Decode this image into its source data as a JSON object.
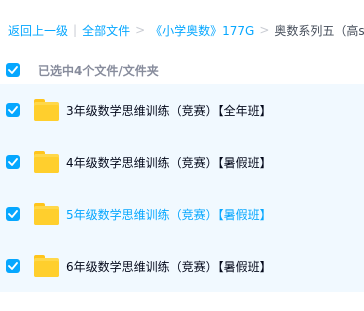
{
  "breadcrumb": {
    "back": "返回上一级",
    "sep1": "|",
    "all_files": "全部文件",
    "sep2": ">",
    "folder": "《小学奥数》177G",
    "sep3": ">",
    "current": "奥数系列五（高s思"
  },
  "selection": {
    "count_text": "已选中4个文件/文件夹",
    "checked": true
  },
  "files": [
    {
      "name": "3年级数学思维训练（竞赛）【全年班】",
      "checked": true,
      "hovered": false
    },
    {
      "name": "4年级数学思维训练（竞赛）【暑假班】",
      "checked": true,
      "hovered": false
    },
    {
      "name": "5年级数学思维训练（竞赛）【暑假班】",
      "checked": true,
      "hovered": true
    },
    {
      "name": "6年级数学思维训练（竞赛）【暑假班】",
      "checked": true,
      "hovered": false
    }
  ],
  "colors": {
    "accent": "#06a7ff",
    "row_background": "#f1f9ff",
    "folder": "#ffcf2d"
  },
  "icons": {
    "checkbox": "checkmark-icon",
    "folder": "folder-icon"
  }
}
